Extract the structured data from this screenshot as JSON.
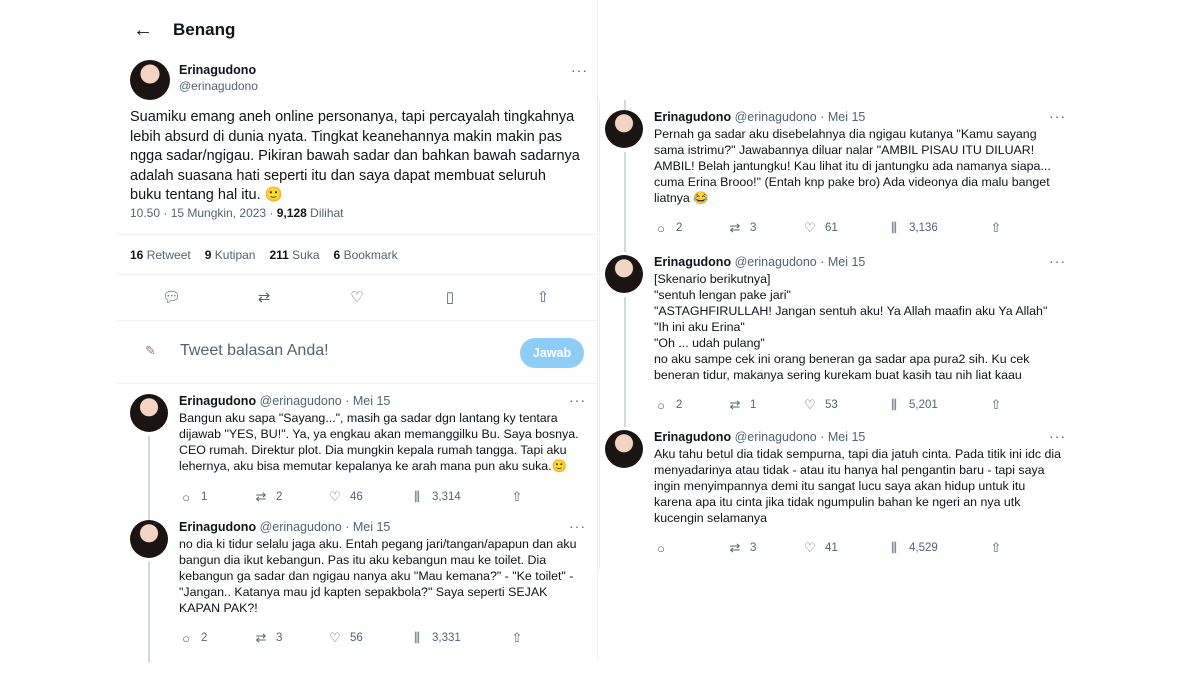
{
  "header": {
    "back_icon": "arrow-left-icon",
    "title": "Benang"
  },
  "main_tweet": {
    "name": "Erinagudono",
    "handle": "@erinagudono",
    "more": "···",
    "text": "Suamiku emang aneh online personanya, tapi percayalah tingkahnya lebih absurd di dunia nyata. Tingkat keanehannya makin makin pas ngga sadar/ngigau. Pikiran bawah sadar dan bahkan bawah sadarnya adalah suasana hati seperti itu dan saya dapat membuat seluruh buku tentang hal itu. 🙂",
    "time": "10.50 · 15 Mungkin, 2023 ·",
    "views_count": "9,128",
    "views_label": "Dilihat",
    "stats": {
      "retweets_count": "16",
      "retweets_label": "Retweet",
      "quotes_count": "9",
      "quotes_label": "Kutipan",
      "likes_count": "211",
      "likes_label": "Suka",
      "bookmarks_count": "6",
      "bookmarks_label": "Bookmark"
    }
  },
  "reply_box": {
    "placeholder": "Tweet balasan Anda!",
    "button": "Jawab"
  },
  "left_replies": [
    {
      "name": "Erinagudono",
      "handle_date": "@erinagudono · Mei 15",
      "text": "Bangun aku sapa \"Sayang...\", masih ga sadar dgn lantang ky tentara dijawab \"YES, BU!\". Ya, ya engkau akan memanggilku Bu. Saya bosnya. CEO rumah. Direktur plot. Dia mungkin kepala rumah tangga. Tapi aku lehernya, aku bisa memutar kepalanya ke arah mana pun aku suka.🙂",
      "replies": "1",
      "retweets": "2",
      "likes": "46",
      "views": "3,314"
    },
    {
      "name": "Erinagudono",
      "handle_date": "@erinagudono · Mei 15",
      "text": "no dia ki tidur selalu jaga aku. Entah pegang jari/tangan/apapun dan aku bangun dia ikut kebangun. Pas itu aku kebangun mau ke toilet. Dia kebangun ga sadar dan ngigau nanya aku \"Mau kemana?\" - \"Ke toilet\" - \"Jangan.. Katanya mau jd kapten sepakbola?\" Saya seperti SEJAK KAPAN PAK?!",
      "replies": "2",
      "retweets": "3",
      "likes": "56",
      "views": "3,331"
    }
  ],
  "right_replies": [
    {
      "name": "Erinagudono",
      "handle_date": "@erinagudono · Mei 15",
      "text": "Pernah ga sadar aku disebelahnya dia ngigau kutanya \"Kamu sayang sama istrimu?\" Jawabannya diluar nalar \"AMBIL PISAU ITU DILUAR! AMBIL! Belah jantungku! Kau lihat itu di jantungku ada namanya siapa... cuma Erina Brooo!\" (Entah knp pake bro) Ada videonya dia malu banget liatnya 😂",
      "replies": "2",
      "retweets": "3",
      "likes": "61",
      "views": "3,136"
    },
    {
      "name": "Erinagudono",
      "handle_date": "@erinagudono · Mei 15",
      "lines": [
        "[Skenario berikutnya]",
        "\"sentuh lengan pake jari\"",
        "\"ASTAGHFIRULLAH! Jangan sentuh aku! Ya Allah maafin aku Ya Allah\"",
        "\"Ih ini aku Erina\"",
        "\"Oh ... udah pulang\"",
        "no aku sampe cek ini orang beneran ga sadar apa pura2 sih. Ku cek beneran tidur, makanya sering kurekam buat kasih tau nih liat kaau"
      ],
      "replies": "2",
      "retweets": "1",
      "likes": "53",
      "views": "5,201"
    },
    {
      "name": "Erinagudono",
      "handle_date": "@erinagudono · Mei 15",
      "text": "Aku tahu betul dia tidak sempurna, tapi dia jatuh cinta. Pada titik ini idc dia menyadarinya atau tidak - atau itu hanya hal pengantin baru - tapi saya ingin menyimpannya demi itu sangat lucu saya akan hidup untuk itu karena apa itu cinta jika tidak ngumpulin bahan ke ngeri an nya utk kucengin selamanya",
      "replies": "",
      "retweets": "3",
      "likes": "41",
      "views": "4,529"
    }
  ],
  "icons": {
    "reply": "reply-icon",
    "retweet": "retweet-icon",
    "like": "heart-icon",
    "views": "views-icon",
    "share": "share-icon",
    "bookmark": "bookmark-icon"
  }
}
